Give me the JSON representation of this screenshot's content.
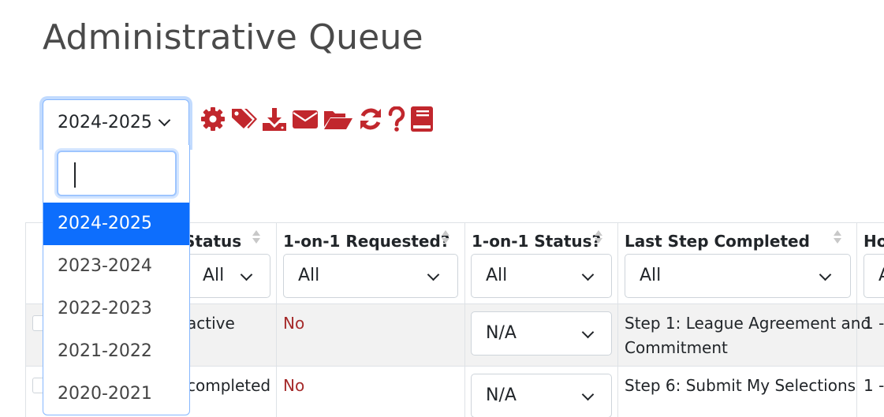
{
  "page": {
    "title": "Administrative Queue"
  },
  "toolbar": {
    "year_select": {
      "value": "2024-2025"
    },
    "icons": [
      "gear-icon",
      "tags-icon",
      "download-icon",
      "envelope-icon",
      "folder-open-icon",
      "refresh-icon",
      "question-icon",
      "book-icon"
    ],
    "accent_color": "#c1272d"
  },
  "year_dropdown": {
    "search_value": "",
    "options": [
      "2024-2025",
      "2023-2024",
      "2022-2023",
      "2021-2022",
      "2020-2021"
    ],
    "selected": "2024-2025"
  },
  "table": {
    "columns": [
      {
        "label": "Status",
        "filter": "All"
      },
      {
        "label": "1-on-1 Requested?",
        "filter": "All"
      },
      {
        "label": "1-on-1 Status?",
        "filter": "All"
      },
      {
        "label": "Last Step Completed",
        "filter": "All"
      },
      {
        "label": "Ho",
        "filter": "A"
      }
    ],
    "rows": [
      {
        "status": "active",
        "requested": "No",
        "one_on_one_status": "N/A",
        "last_step_line1": "Step 1: League Agreement and",
        "last_step_line2": "Commitment",
        "ho": "1 -"
      },
      {
        "status": "completed",
        "requested": "No",
        "one_on_one_status": "N/A",
        "last_step_line1": "Step 6: Submit My Selections",
        "last_step_line2": "",
        "ho": "1 -"
      }
    ]
  }
}
